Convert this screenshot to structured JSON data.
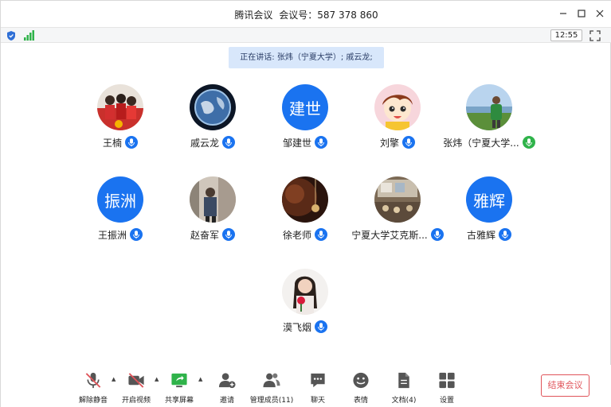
{
  "window": {
    "app_name": "腾讯会议",
    "meeting_id_label": "会议号：",
    "meeting_id": "587 378 860"
  },
  "statusbar": {
    "time": "12:55"
  },
  "speaking": {
    "text": "正在讲话: 张炜（宁夏大学）; 戚云龙;"
  },
  "participants": [
    {
      "name": "王楠",
      "avatar_type": "photo-group-red",
      "mic": "muted-blue"
    },
    {
      "name": "戚云龙",
      "avatar_type": "photo-earth",
      "mic": "muted-blue"
    },
    {
      "name": "邹建世",
      "avatar_type": "text",
      "avatar_text": "建世",
      "mic": "muted-blue"
    },
    {
      "name": "刘擎",
      "avatar_type": "cartoon",
      "mic": "muted-blue"
    },
    {
      "name": "张炜（宁夏大学...",
      "avatar_type": "photo-field",
      "mic": "active-green"
    },
    {
      "name": "王振洲",
      "avatar_type": "text",
      "avatar_text": "振洲",
      "mic": "muted-blue"
    },
    {
      "name": "赵奋军",
      "avatar_type": "photo-man",
      "mic": "muted-blue"
    },
    {
      "name": "徐老师",
      "avatar_type": "photo-dark",
      "mic": "muted-blue"
    },
    {
      "name": "宁夏大学艾克斯...",
      "avatar_type": "photo-room",
      "mic": "muted-blue"
    },
    {
      "name": "古雅辉",
      "avatar_type": "text",
      "avatar_text": "雅辉",
      "mic": "muted-blue"
    },
    {
      "name": "漠飞烟",
      "avatar_type": "photo-woman",
      "mic": "muted-blue"
    }
  ],
  "toolbar": {
    "unmute": "解除静音",
    "start_video": "开启视频",
    "share_screen": "共享屏幕",
    "invite": "邀请",
    "manage_members": "管理成员(11)",
    "chat": "聊天",
    "emoji": "表情",
    "docs": "文档(4)",
    "settings": "设置",
    "end_meeting": "结束会议"
  },
  "colors": {
    "accent_blue": "#1a73f0",
    "mic_active_green": "#2fb34a",
    "end_red": "#e0545a",
    "speaking_bg": "#d8e7fb"
  }
}
